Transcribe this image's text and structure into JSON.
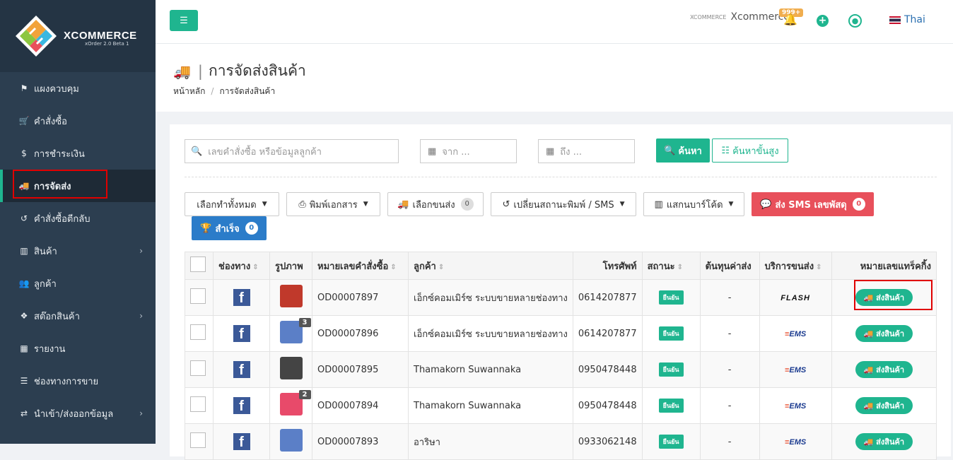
{
  "brand": {
    "name": "XCOMMERCE",
    "version": "xOrder 2.0 Beta 1"
  },
  "sidebar": {
    "items": [
      {
        "icon": "flag-icon",
        "glyph": "⚑",
        "label": "แผงควบคุม",
        "chevron": false,
        "active": false
      },
      {
        "icon": "cart-icon",
        "glyph": "🛒",
        "label": "คำสั่งซื้อ",
        "chevron": false,
        "active": false
      },
      {
        "icon": "dollar-icon",
        "glyph": "$",
        "label": "การชำระเงิน",
        "chevron": false,
        "active": false
      },
      {
        "icon": "truck-icon",
        "glyph": "🚚",
        "label": "การจัดส่ง",
        "chevron": false,
        "active": true
      },
      {
        "icon": "undo-icon",
        "glyph": "↺",
        "label": "คำสั่งซื้อตีกลับ",
        "chevron": false,
        "active": false
      },
      {
        "icon": "barcode-icon",
        "glyph": "▥",
        "label": "สินค้า",
        "chevron": true,
        "active": false
      },
      {
        "icon": "users-icon",
        "glyph": "👥",
        "label": "ลูกค้า",
        "chevron": false,
        "active": false
      },
      {
        "icon": "cubes-icon",
        "glyph": "❖",
        "label": "สต๊อกสินค้า",
        "chevron": true,
        "active": false
      },
      {
        "icon": "chart-icon",
        "glyph": "▦",
        "label": "รายงาน",
        "chevron": false,
        "active": false
      },
      {
        "icon": "list-icon",
        "glyph": "☰",
        "label": "ช่องทางการขาย",
        "chevron": false,
        "active": false
      },
      {
        "icon": "exchange-icon",
        "glyph": "⇄",
        "label": "นำเข้า/ส่งออกข้อมูล",
        "chevron": true,
        "active": false
      }
    ]
  },
  "topbar": {
    "brand_small": "XCOMMERCE",
    "brand_label": "Xcommerce",
    "notif_badge": "999+",
    "language": "Thai"
  },
  "page": {
    "title": "การจัดส่งสินค้า",
    "breadcrumb_home": "หน้าหลัก",
    "breadcrumb_current": "การจัดส่งสินค้า"
  },
  "filters": {
    "search_placeholder": "เลขคำสั่งซื้อ หรือข้อมูลลูกค้า",
    "date_from": "จาก ...",
    "date_to": "ถึง ...",
    "search_btn": "ค้นหา",
    "advanced_btn": "ค้นหาขั้นสูง"
  },
  "toolbar": {
    "select_all": "เลือกทำทั้งหมด",
    "print_docs": "พิมพ์เอกสาร",
    "select_courier": "เลือกขนส่ง",
    "select_courier_count": "0",
    "change_status": "เปลี่ยนสถานะพิมพ์ / SMS",
    "scan_barcode": "แสกนบาร์โค้ด",
    "send_sms": "ส่ง SMS เลขพัสดุ",
    "send_sms_count": "0",
    "success": "สำเร็จ",
    "success_count": "0"
  },
  "table": {
    "headers": {
      "channel": "ช่องทาง",
      "image": "รูปภาพ",
      "order_no": "หมายเลขคำสั่งซื้อ",
      "customer": "ลูกค้า",
      "phone": "โทรศัพท์",
      "status": "สถานะ",
      "cost": "ต้นทุนค่าส่ง",
      "courier": "บริการขนส่ง",
      "tracking": "หมายเลขแทร็คกิ้ง"
    },
    "rows": [
      {
        "channel": "f",
        "img_count": "",
        "img_color": "#c0392b",
        "order_no": "OD00007897",
        "customer": "เอ็กซ์คอมเมิร์ซ ระบบขายหลายช่องทาง",
        "phone": "0614207877",
        "status": "ยืนยัน",
        "cost": "-",
        "courier": "FLASH",
        "courier_kind": "flash",
        "action": "ส่งสินค้า"
      },
      {
        "channel": "f",
        "img_count": "3",
        "img_color": "#5b7fc7",
        "order_no": "OD00007896",
        "customer": "เอ็กซ์คอมเมิร์ซ ระบบขายหลายช่องทาง",
        "phone": "0614207877",
        "status": "ยืนยัน",
        "cost": "-",
        "courier": "EMS",
        "courier_kind": "ems",
        "action": "ส่งสินค้า"
      },
      {
        "channel": "f",
        "img_count": "",
        "img_color": "#444444",
        "order_no": "OD00007895",
        "customer": "Thamakorn Suwannaka",
        "phone": "0950478448",
        "status": "ยืนยัน",
        "cost": "-",
        "courier": "EMS",
        "courier_kind": "ems",
        "action": "ส่งสินค้า"
      },
      {
        "channel": "f",
        "img_count": "2",
        "img_color": "#e84a6a",
        "order_no": "OD00007894",
        "customer": "Thamakorn Suwannaka",
        "phone": "0950478448",
        "status": "ยืนยัน",
        "cost": "-",
        "courier": "EMS",
        "courier_kind": "ems",
        "action": "ส่งสินค้า"
      },
      {
        "channel": "f",
        "img_count": "",
        "img_color": "#5b7fc7",
        "order_no": "OD00007893",
        "customer": "อาริษา",
        "phone": "0933062148",
        "status": "ยืนยัน",
        "cost": "-",
        "courier": "EMS",
        "courier_kind": "ems",
        "action": "ส่งสินค้า"
      }
    ]
  },
  "colors": {
    "accent": "#1fb58f",
    "sidebar": "#2c3e50",
    "danger": "#e8505b",
    "primary": "#2b7cc9",
    "highlight": "#e00000"
  }
}
